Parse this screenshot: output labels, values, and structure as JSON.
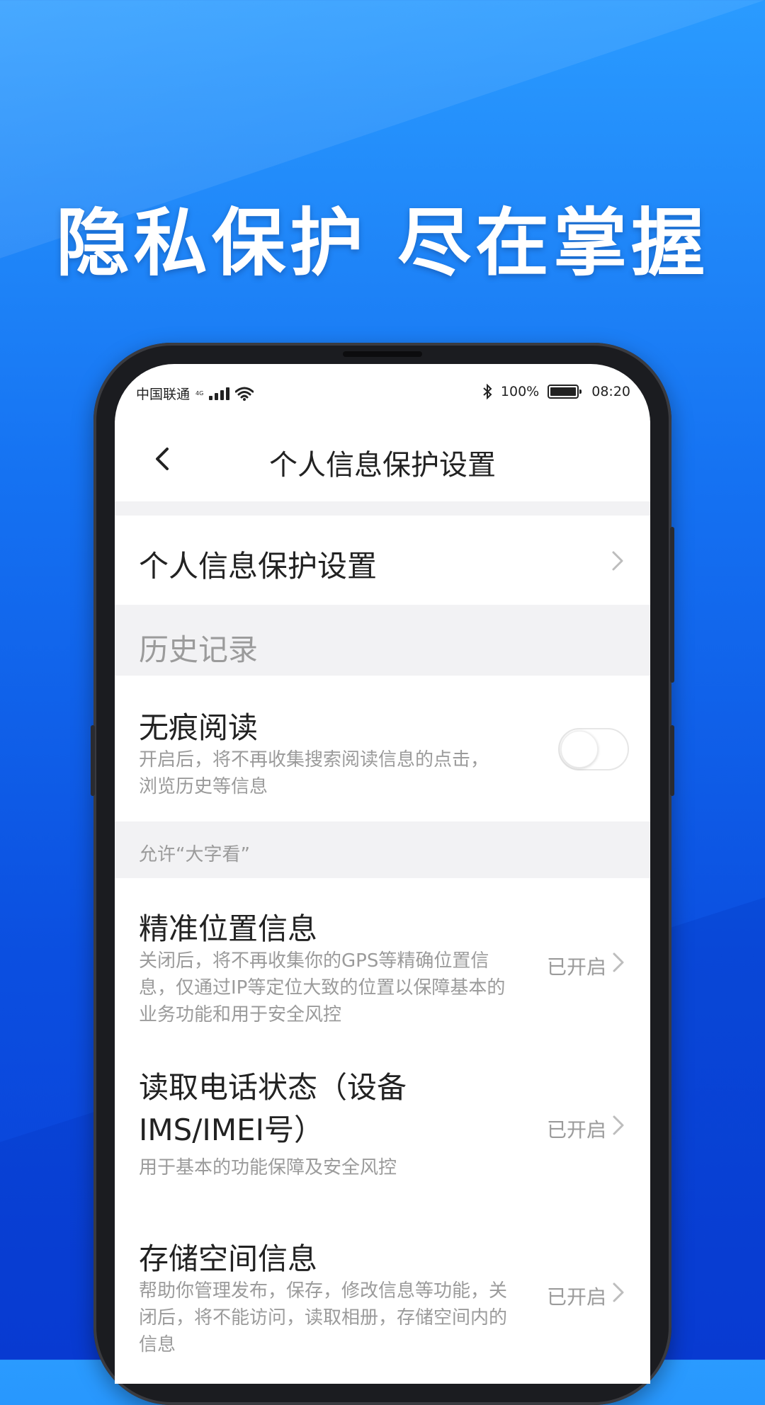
{
  "headline": "隐私保护 尽在掌握",
  "status_bar": {
    "carrier": "中国联通",
    "network": "4G",
    "battery": "100%",
    "time": "08:20",
    "icons": [
      "signal-icon",
      "wifi-icon",
      "bluetooth-icon",
      "battery-icon"
    ]
  },
  "nav": {
    "back_icon": "chevron-left-icon",
    "title": "个人信息保护设置"
  },
  "entry_row": {
    "label": "个人信息保护设置"
  },
  "history": {
    "header": "历史记录",
    "incognito": {
      "title": "无痕阅读",
      "desc": "开启后，将不再收集搜索阅读信息的点击，浏览历史等信息",
      "toggle_on": false
    }
  },
  "permissions": {
    "header": "允许“大字看”",
    "items": [
      {
        "title": "精准位置信息",
        "desc": "关闭后，将不再收集你的GPS等精确位置信息，仅通过IP等定位大致的位置以保障基本的业务功能和用于安全风控",
        "status": "已开启"
      },
      {
        "title": "读取电话状态（设备IMS/IMEI号）",
        "desc": "用于基本的功能保障及安全风控",
        "status": "已开启"
      },
      {
        "title": "存储空间信息",
        "desc": "帮助你管理发布，保存，修改信息等功能，关闭后，将不能访问，读取相册，存储空间内的信息",
        "status": "已开启"
      }
    ]
  },
  "colors": {
    "background_top": "#2a9bff",
    "background_bottom": "#0a3fd8",
    "phone_frame": "#1b1c20",
    "secondary_text": "#9b9b9b"
  }
}
